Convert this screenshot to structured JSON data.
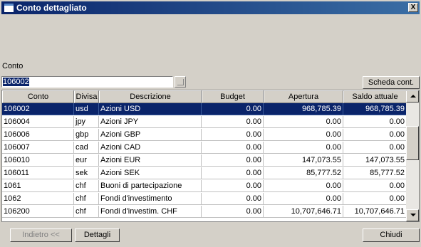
{
  "window": {
    "title": "Conto dettagliato",
    "close_label": "X"
  },
  "conto": {
    "label": "Conto",
    "value": "106002"
  },
  "buttons": {
    "scheda": "Scheda cont.",
    "indietro": "Indietro <<",
    "dettagli": "Dettagli",
    "chiudi": "Chiudi"
  },
  "table": {
    "columns": [
      "Conto",
      "Divisa",
      "Descrizione",
      "Budget",
      "Apertura",
      "Saldo attuale"
    ],
    "rows": [
      {
        "conto": "106002",
        "divisa": "usd",
        "descrizione": "Azioni USD",
        "budget": "0.00",
        "apertura": "968,785.39",
        "saldo": "968,785.39"
      },
      {
        "conto": "106004",
        "divisa": "jpy",
        "descrizione": "Azioni JPY",
        "budget": "0.00",
        "apertura": "0.00",
        "saldo": "0.00"
      },
      {
        "conto": "106006",
        "divisa": "gbp",
        "descrizione": "Azioni GBP",
        "budget": "0.00",
        "apertura": "0.00",
        "saldo": "0.00"
      },
      {
        "conto": "106007",
        "divisa": "cad",
        "descrizione": "Azioni CAD",
        "budget": "0.00",
        "apertura": "0.00",
        "saldo": "0.00"
      },
      {
        "conto": "106010",
        "divisa": "eur",
        "descrizione": "Azioni EUR",
        "budget": "0.00",
        "apertura": "147,073.55",
        "saldo": "147,073.55"
      },
      {
        "conto": "106011",
        "divisa": "sek",
        "descrizione": "Azioni SEK",
        "budget": "0.00",
        "apertura": "85,777.52",
        "saldo": "85,777.52"
      },
      {
        "conto": "1061",
        "divisa": "chf",
        "descrizione": "Buoni di partecipazione",
        "budget": "0.00",
        "apertura": "0.00",
        "saldo": "0.00"
      },
      {
        "conto": "1062",
        "divisa": "chf",
        "descrizione": "Fondi d'investimento",
        "budget": "0.00",
        "apertura": "0.00",
        "saldo": "0.00"
      },
      {
        "conto": "106200",
        "divisa": "chf",
        "descrizione": "Fondi d'investim. CHF",
        "budget": "0.00",
        "apertura": "10,707,646.71",
        "saldo": "10,707,646.71"
      }
    ],
    "selected_row": 0
  },
  "colors": {
    "title_bar": "#0a246a",
    "selection": "#0a246a",
    "face": "#d4d0c8"
  }
}
